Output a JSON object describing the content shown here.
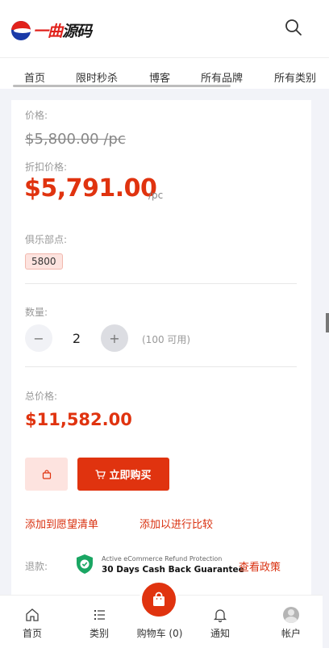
{
  "header": {
    "logo_text_red": "一曲",
    "logo_text_dark": "源码",
    "search_icon": "search-icon"
  },
  "nav": {
    "items": [
      {
        "label": "首页"
      },
      {
        "label": "限时秒杀"
      },
      {
        "label": "博客"
      },
      {
        "label": "所有品牌"
      },
      {
        "label": "所有类别"
      }
    ]
  },
  "product": {
    "price_label": "价格:",
    "original_price": "$5,800.00 /pc",
    "discount_label": "折扣价格:",
    "discount_price": "$5,791.00",
    "unit": "/pc",
    "club_points_label": "俱乐部点:",
    "club_points": "5800",
    "quantity_label": "数量:",
    "quantity": "2",
    "minus": "−",
    "plus": "+",
    "available": "(100 可用)",
    "total_label": "总价格:",
    "total_price": "$11,582.00",
    "buy_now": "立即购买",
    "add_wishlist": "添加到愿望清单",
    "add_compare": "添加以进行比较",
    "refund_label": "退款:",
    "refund_small": "Active eCommerce Refund Protection",
    "refund_big": "30 Days Cash Back Guarantee",
    "view_policy": "查看政策"
  },
  "bottom_nav": {
    "home": "首页",
    "categories": "类别",
    "cart": "购物车 (0)",
    "notifications": "通知",
    "account": "帐户"
  },
  "colors": {
    "accent": "#e0330f",
    "accent_light": "#fde3df",
    "shield_green": "#1aa663"
  }
}
